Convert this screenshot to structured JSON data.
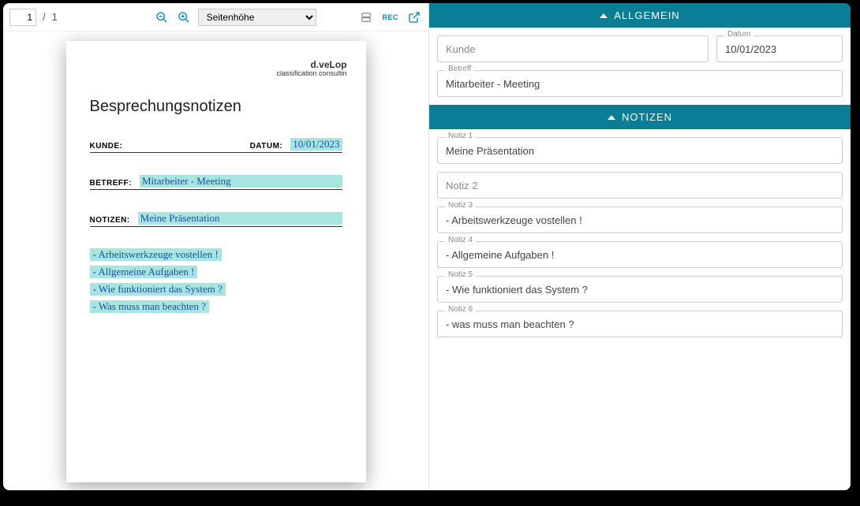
{
  "toolbar": {
    "current_page": "1",
    "total_pages": "1",
    "zoom_mode": "Seitenhöhe",
    "rec_label": "REC"
  },
  "document": {
    "logo_line1": "d.veLop",
    "logo_line2": "classification consultin",
    "title": "Besprechungsnotizen",
    "kunde_label": "KUNDE:",
    "datum_label": "DATUM:",
    "datum_value": "10/01/2023",
    "betreff_label": "BETREFF:",
    "betreff_value": "Mitarbeiter - Meeting",
    "notizen_label": "NOTIZEN:",
    "notizen_value": "Meine Präsentation",
    "notes": [
      "- Arbeitswerkzeuge vostellen !",
      "- Allgemeine Aufgaben !",
      "- Wie funktioniert das System ?",
      "- Was muss man beachten ?"
    ]
  },
  "sections": {
    "allgemein": {
      "title": "ALLGEMEIN",
      "kunde_placeholder": "Kunde",
      "datum_label": "Datum",
      "datum_value": "10/01/2023",
      "betreff_label": "Betreff",
      "betreff_value": "Mitarbeiter - Meeting"
    },
    "notizen": {
      "title": "NOTIZEN",
      "fields": [
        {
          "label": "Notiz 1",
          "value": "Meine Präsentation"
        },
        {
          "label": "",
          "value": "",
          "placeholder": "Notiz 2"
        },
        {
          "label": "Notiz 3",
          "value": "- Arbeitswerkzeuge vostellen !"
        },
        {
          "label": "Notiz 4",
          "value": "- Allgemeine Aufgaben !"
        },
        {
          "label": "Notiz 5",
          "value": "- Wie funktioniert das System ?"
        },
        {
          "label": "Notiz 6",
          "value": "- was muss man beachten ?"
        }
      ]
    }
  }
}
